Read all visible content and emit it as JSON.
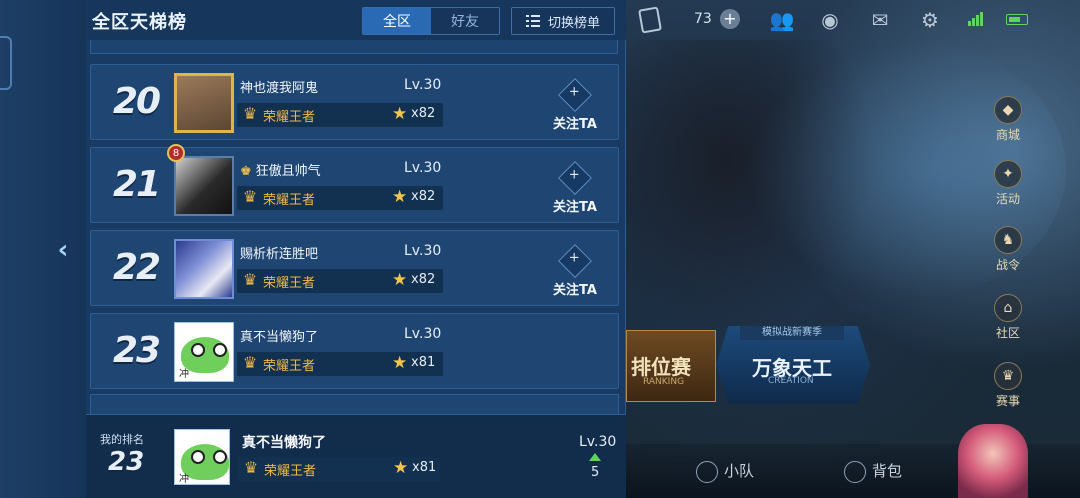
{
  "panel": {
    "title": "全区天梯榜",
    "tabs": [
      {
        "label": "全区",
        "active": true
      },
      {
        "label": "好友",
        "active": false
      }
    ],
    "switch_label": "切换榜单"
  },
  "rows": [
    {
      "rank": "20",
      "name": "神也渡我阿鬼",
      "level": "Lv.30",
      "tier": "荣耀王者",
      "stars": "x82",
      "follow": "关注TA",
      "avatar": "gold"
    },
    {
      "rank": "21",
      "name": "狂傲且帅气",
      "level": "Lv.30",
      "tier": "荣耀王者",
      "stars": "x82",
      "follow": "关注TA",
      "avatar": "dark",
      "badge": "8"
    },
    {
      "rank": "22",
      "name": "赐析析连胜吧",
      "level": "Lv.30",
      "tier": "荣耀王者",
      "stars": "x82",
      "follow": "关注TA",
      "avatar": "anime"
    },
    {
      "rank": "23",
      "name": "真不当懒狗了",
      "level": "Lv.30",
      "tier": "荣耀王者",
      "stars": "x81",
      "avatar": "frog",
      "frog_text": "冲"
    }
  ],
  "my_rank": {
    "label": "我的排名",
    "rank": "23",
    "name": "真不当懒狗了",
    "tier": "荣耀王者",
    "stars": "x81",
    "level": "Lv.30",
    "change": "5"
  },
  "topbar": {
    "coins": "73"
  },
  "side_menu": [
    "商城",
    "活动",
    "战令",
    "社区",
    "赛事"
  ],
  "modes": {
    "ranked": {
      "title": "排位赛",
      "sub": "RANKING"
    },
    "creation": {
      "badge": "模拟战新赛季",
      "title": "万象天工",
      "sub": "CREATION"
    }
  },
  "bottom": {
    "team": "小队",
    "bag": "背包"
  },
  "colors": {
    "panel_bg": "#193a63",
    "tier_gold": "#f2b845",
    "up_green": "#5fd45f"
  }
}
